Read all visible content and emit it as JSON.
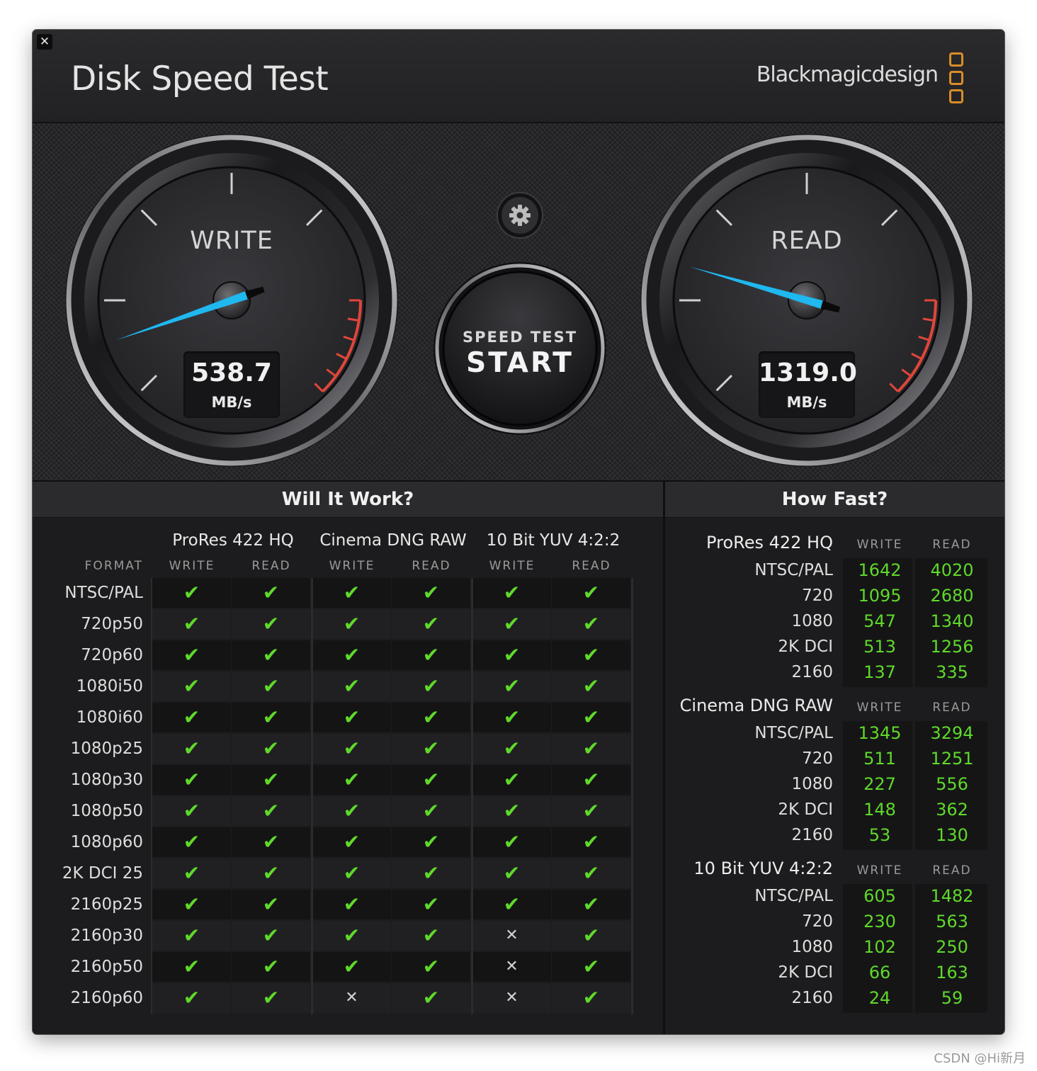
{
  "window": {
    "title": "Disk Speed Test",
    "brand": "Blackmagicdesign",
    "close_glyph": "✕",
    "brand_color": "#d98d28"
  },
  "gauges": {
    "write": {
      "label": "WRITE",
      "value": "538.7",
      "unit": "MB/s",
      "needle_color": "#1fb8ef"
    },
    "read": {
      "label": "READ",
      "value": "1319.0",
      "unit": "MB/s",
      "needle_color": "#1fb8ef"
    },
    "redline_color": "#e0463a"
  },
  "controls": {
    "settings_icon": "gear-icon",
    "start_line1": "SPEED TEST",
    "start_line2": "START"
  },
  "will_it_work": {
    "title": "Will It Work?",
    "format_header": "FORMAT",
    "groups": [
      {
        "name": "ProRes 422 HQ",
        "write": "WRITE",
        "read": "READ"
      },
      {
        "name": "Cinema DNG RAW",
        "write": "WRITE",
        "read": "READ"
      },
      {
        "name": "10 Bit YUV 4:2:2",
        "write": "WRITE",
        "read": "READ"
      }
    ],
    "formats": [
      "NTSC/PAL",
      "720p50",
      "720p60",
      "1080i50",
      "1080i60",
      "1080p25",
      "1080p30",
      "1080p50",
      "1080p60",
      "2K DCI 25",
      "2160p25",
      "2160p30",
      "2160p50",
      "2160p60"
    ],
    "results": [
      [
        true,
        true,
        true,
        true,
        true,
        true
      ],
      [
        true,
        true,
        true,
        true,
        true,
        true
      ],
      [
        true,
        true,
        true,
        true,
        true,
        true
      ],
      [
        true,
        true,
        true,
        true,
        true,
        true
      ],
      [
        true,
        true,
        true,
        true,
        true,
        true
      ],
      [
        true,
        true,
        true,
        true,
        true,
        true
      ],
      [
        true,
        true,
        true,
        true,
        true,
        true
      ],
      [
        true,
        true,
        true,
        true,
        true,
        true
      ],
      [
        true,
        true,
        true,
        true,
        true,
        true
      ],
      [
        true,
        true,
        true,
        true,
        true,
        true
      ],
      [
        true,
        true,
        true,
        true,
        true,
        true
      ],
      [
        true,
        true,
        true,
        true,
        false,
        true
      ],
      [
        true,
        true,
        true,
        true,
        false,
        true
      ],
      [
        true,
        true,
        false,
        true,
        false,
        true
      ]
    ],
    "check_glyph": "✔",
    "cross_glyph": "✕",
    "check_color": "#5fd92a"
  },
  "how_fast": {
    "title": "How Fast?",
    "groups": [
      {
        "name": "ProRes 422 HQ",
        "write": "WRITE",
        "read": "READ",
        "rows": [
          {
            "label": "NTSC/PAL",
            "write": "1642",
            "read": "4020"
          },
          {
            "label": "720",
            "write": "1095",
            "read": "2680"
          },
          {
            "label": "1080",
            "write": "547",
            "read": "1340"
          },
          {
            "label": "2K DCI",
            "write": "513",
            "read": "1256"
          },
          {
            "label": "2160",
            "write": "137",
            "read": "335"
          }
        ]
      },
      {
        "name": "Cinema DNG RAW",
        "write": "WRITE",
        "read": "READ",
        "rows": [
          {
            "label": "NTSC/PAL",
            "write": "1345",
            "read": "3294"
          },
          {
            "label": "720",
            "write": "511",
            "read": "1251"
          },
          {
            "label": "1080",
            "write": "227",
            "read": "556"
          },
          {
            "label": "2K DCI",
            "write": "148",
            "read": "362"
          },
          {
            "label": "2160",
            "write": "53",
            "read": "130"
          }
        ]
      },
      {
        "name": "10 Bit YUV 4:2:2",
        "write": "WRITE",
        "read": "READ",
        "rows": [
          {
            "label": "NTSC/PAL",
            "write": "605",
            "read": "1482"
          },
          {
            "label": "720",
            "write": "230",
            "read": "563"
          },
          {
            "label": "1080",
            "write": "102",
            "read": "250"
          },
          {
            "label": "2K DCI",
            "write": "66",
            "read": "163"
          },
          {
            "label": "2160",
            "write": "24",
            "read": "59"
          }
        ]
      }
    ]
  },
  "watermark": "CSDN @Hi新月"
}
